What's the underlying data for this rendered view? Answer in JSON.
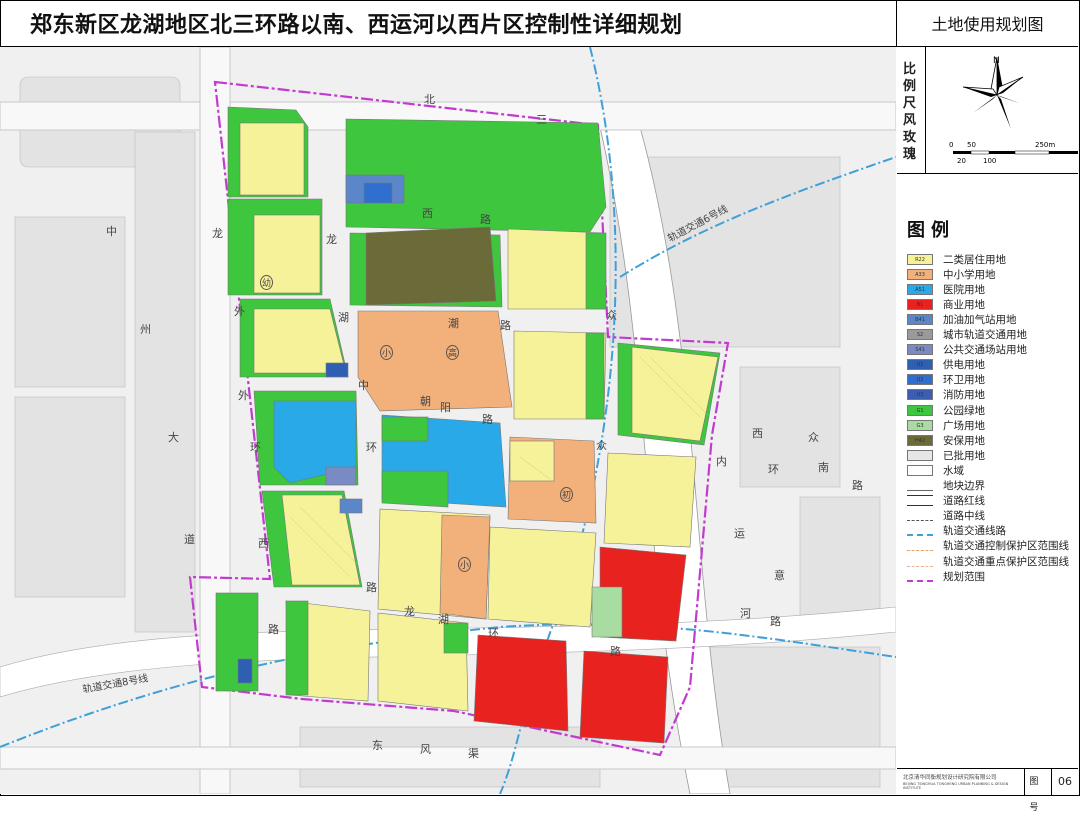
{
  "title": "郑东新区龙湖地区北三环路以南、西运河以西片区控制性详细规划",
  "map_type": "土地使用规划图",
  "compass": {
    "label": "比例尺风玫瑰",
    "north": "N",
    "scale_ticks": [
      "0",
      "50",
      "250m"
    ],
    "scale_ticks_lower": [
      "20",
      "100"
    ]
  },
  "legend": {
    "title": "图例",
    "items": [
      {
        "code": "R22",
        "label": "二类居住用地",
        "color": "#f6f29a"
      },
      {
        "code": "A33",
        "label": "中小学用地",
        "color": "#f2b07a"
      },
      {
        "code": "A51",
        "label": "医院用地",
        "color": "#2aa9e8"
      },
      {
        "code": "B1",
        "label": "商业用地",
        "color": "#e8231f"
      },
      {
        "code": "B41",
        "label": "加油加气站用地",
        "color": "#5b86c9"
      },
      {
        "code": "S2",
        "label": "城市轨道交通用地",
        "color": "#9a9a9a"
      },
      {
        "code": "S41",
        "label": "公共交通场站用地",
        "color": "#7a8bc4"
      },
      {
        "code": "U1",
        "label": "供电用地",
        "color": "#2e5fb3"
      },
      {
        "code": "U2",
        "label": "环卫用地",
        "color": "#2e6fd0"
      },
      {
        "code": "U3",
        "label": "消防用地",
        "color": "#3a5fb0"
      },
      {
        "code": "G1",
        "label": "公园绿地",
        "color": "#3ec63e"
      },
      {
        "code": "G3",
        "label": "广场用地",
        "color": "#a8dca0"
      },
      {
        "code": "H42",
        "label": "安保用地",
        "color": "#6b6b3a"
      },
      {
        "code": "",
        "label": "已批用地",
        "color": "#e6e6e6"
      },
      {
        "code": "",
        "label": "水域",
        "color": "#ffffff"
      },
      {
        "code": "",
        "label": "地块边界",
        "color": "#ffffff"
      },
      {
        "code": "",
        "label": "道路红线",
        "color": "#ffffff"
      },
      {
        "code": "",
        "label": "道路中线",
        "color": "#ffffff"
      },
      {
        "code": "",
        "label": "轨道交通线路",
        "color": "#ffffff"
      },
      {
        "code": "",
        "label": "轨道交通控制保护区范围线",
        "color": "#ffffff"
      },
      {
        "code": "",
        "label": "轨道交通重点保护区范围线",
        "color": "#ffffff"
      },
      {
        "code": "",
        "label": "规划范围",
        "color": "#ffffff"
      }
    ]
  },
  "footer": {
    "org": "北京清华同衡规划设计研究院有限公司",
    "org_en": "BEIJING TSINGHUA TONGHENG URBAN PLANNING & DESIGN INSTITUTE",
    "label": "图号",
    "number": "06"
  },
  "map": {
    "roads": [
      "北三环",
      "西运河路",
      "龙湖外环路",
      "龙湖中环路",
      "龙湖内环路",
      "朝阳路",
      "津潮路",
      "众意南路",
      "西运河",
      "东风渠",
      "中州大道"
    ],
    "rail_labels": [
      "轨道交通6号线",
      "轨道交通8号线"
    ],
    "road_chars": {
      "north": [
        "北",
        "三",
        "环"
      ],
      "xi": [
        "西",
        "路"
      ],
      "long": [
        "龙",
        "湖"
      ],
      "wai": [
        "外",
        "环"
      ],
      "zhong": [
        "中",
        "环"
      ],
      "chaoyang": [
        "朝",
        "阳",
        "路"
      ],
      "jinchao": [
        "津",
        "潮",
        "路"
      ],
      "zhongyi": [
        "众",
        "意",
        "南",
        "路"
      ],
      "xiyunhe": [
        "西",
        "运",
        "河"
      ],
      "dongfengqu": [
        "东",
        "风",
        "渠"
      ],
      "zhongzhou": [
        "中",
        "州",
        "大",
        "道"
      ],
      "neihuan": [
        "内",
        "环",
        "路"
      ]
    },
    "facility_marks": [
      "幼",
      "小",
      "高",
      "初",
      "小"
    ]
  }
}
